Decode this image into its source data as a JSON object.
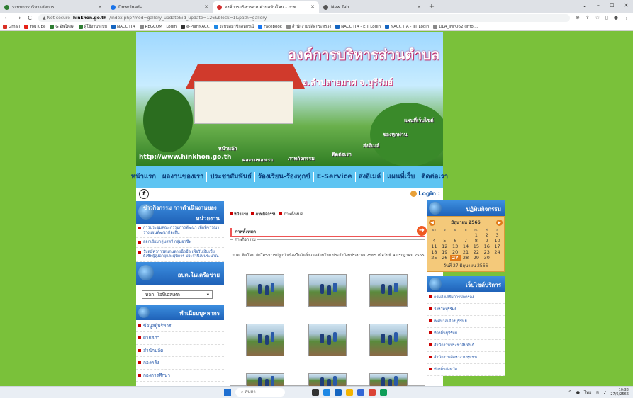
{
  "browser": {
    "tabs": [
      {
        "label": "ระบบการบริหารจัดการ...",
        "active": false
      },
      {
        "label": "Downloads",
        "active": false
      },
      {
        "label": "องค์การบริหารส่วนตำบลหินโคน - ภาพ...",
        "active": true
      },
      {
        "label": "New Tab",
        "active": false
      }
    ],
    "new_tab": "+",
    "window_controls": [
      "⌄",
      "–",
      "⧠",
      "✕"
    ],
    "nav": {
      "back": "←",
      "forward": "→",
      "reload": "C"
    },
    "address": {
      "warning": "▲ Not secure",
      "domain": "hinkhon.go.th",
      "path": "/index.php?mod=gallery_update&id_update=126&block=1&path=gallery"
    },
    "bookmarks": [
      "Gmail",
      "YouTube",
      "G อัพโหลด",
      "ผู้ใช้งานระบบ",
      "NACC ITA",
      "REGCOM : Login",
      "e-PlanNACC",
      "ระบบสมาชิกสหกรณ์",
      "Facebook",
      "สำนักงานปลัดกระทรวง",
      "NACC ITA - EIT Login",
      "NACC ITA - IIT Login",
      "DLA_INFO62 (infol..."
    ]
  },
  "site": {
    "banner_title": "องค์การบริหารส่วนตำบล หินโคน",
    "banner_sub": "อ.ลำปลายมาศ จ.บุรีรัมย์",
    "banner_url": "http://www.hinkhon.go.th",
    "banner_hints": [
      "หน้าหลัก",
      "ผลงานของเรา",
      "ภาพกิจกรรม",
      "ติดต่อเรา",
      "ส่งอีเมล์",
      "ของทุกท่าน",
      "แผนที่เว็บไซต์"
    ],
    "menu": [
      "หน้าแรก",
      "ผลงานของเรา",
      "ประชาสัมพันธ์",
      "ร้องเรียน-ร้องทุกข์",
      "E-Service",
      "ส่งอีเมล์",
      "แผนที่เว็บ",
      "ติดต่อเรา"
    ],
    "login": "Login :",
    "left": {
      "news_title_1": "ข่าวกิจกรรม การดำเนินงานของ",
      "news_title_2": "หน่วยงาน",
      "news_items": [
        "การประชุมคณะกรรมการพัฒนา เพื่อพิจารณาร่างแผนพัฒนาท้องถิ่น",
        "ออกเยี่ยมกลุ่มสตรี กลุ่มอาชีพ",
        "รับสมัครการสแกนลายนิ้วมือ เพื่อรับเงินเบี้ยยังชีพผู้สูงอายุและผู้พิการ ประจำปีงบประมาณ"
      ],
      "network_title": "อบต.ในเครือข่าย",
      "network_select": "หลก. โอทีเอสเทค",
      "personnel_title": "ทำเนียบบุคลากร",
      "personnel_items": [
        "ข้อมูลผู้บริหาร",
        "ฝ่ายสภา",
        "สำนักปลัด",
        "กองคลัง",
        "กองการศึกษา"
      ]
    },
    "center": {
      "breadcrumbs": [
        "หน้าแรก",
        "ภาพกิจกรรม",
        "ภาพทั้งหมด"
      ],
      "section": "ภาพทั้งหมด",
      "legend": "ภาพกิจกรรม",
      "caption": "อบต. หินโคน จัดโครงการปลูกป่าเนื่องในวันสิ่งแวดล้อมโลก ประจำปีงบประมาณ 2565 เมื่อวันที่ 4 กรกฎาคม 2565"
    },
    "right": {
      "calendar_title": "ปฏิทินกิจกรรม",
      "month_label": "มิถุนายน 2566",
      "weekdays": [
        "อา",
        "จ",
        "อ",
        "พ",
        "พฤ",
        "ศ",
        "ส"
      ],
      "weeks": [
        [
          "",
          "",
          "",
          "",
          "1",
          "2",
          "3"
        ],
        [
          "4",
          "5",
          "6",
          "7",
          "8",
          "9",
          "10"
        ],
        [
          "11",
          "12",
          "13",
          "14",
          "15",
          "16",
          "17"
        ],
        [
          "18",
          "19",
          "20",
          "21",
          "22",
          "23",
          "24"
        ],
        [
          "25",
          "26",
          "27",
          "28",
          "29",
          "30",
          ""
        ]
      ],
      "today": "27",
      "today_label": "วันที่ 27 มิถุนายน 2566",
      "services_title": "เว็บไซต์บริการ",
      "services": [
        "กรมส่งเสริมการปกครอง",
        "จังหวัดบุรีรัมย์",
        "เทศบาลเมืองบุรีรัมย์",
        "ท้องถิ่นบุรีรัมย์",
        "สำนักงานประชาสัมพันธ์",
        "สำนักงานจัดหางานชุมชน",
        "ท้องถิ่นจังหวัด"
      ]
    }
  },
  "taskbar": {
    "search": "ค้นหา",
    "tray_lang": "ไทย",
    "time": "10:32",
    "date": "27/6/2566"
  },
  "colors": {
    "page_bg": "#7ac13a",
    "menubar": "#5ec4f2",
    "panel_blue": "#1f62b8",
    "accent_red": "#cc0000",
    "calendar": "#f4c97a"
  }
}
